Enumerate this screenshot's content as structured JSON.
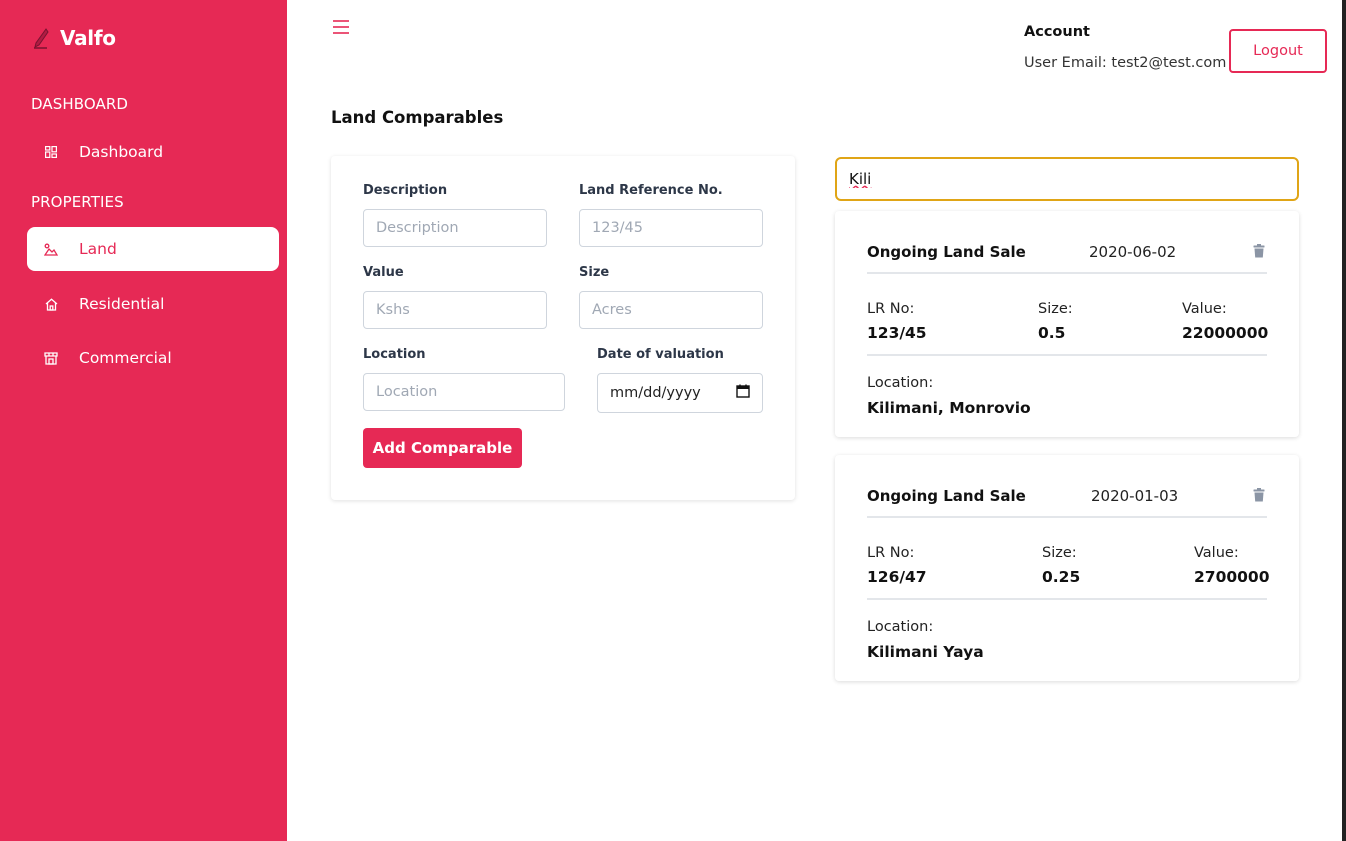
{
  "brand": {
    "name": "Valfo",
    "accent": "#e62955"
  },
  "sidebar": {
    "sections": [
      {
        "label": "DASHBOARD"
      },
      {
        "label": "PROPERTIES"
      }
    ],
    "items": [
      {
        "label": "Dashboard",
        "icon": "grid-icon",
        "active": false
      },
      {
        "label": "Land",
        "icon": "land-icon",
        "active": true
      },
      {
        "label": "Residential",
        "icon": "home-icon",
        "active": false
      },
      {
        "label": "Commercial",
        "icon": "store-icon",
        "active": false
      }
    ]
  },
  "header": {
    "account_title": "Account",
    "account_email": "User Email: test2@test.com",
    "logout_label": "Logout"
  },
  "page": {
    "title": "Land Comparables"
  },
  "form": {
    "description": {
      "label": "Description",
      "placeholder": "Description"
    },
    "reference": {
      "label": "Land Reference No.",
      "placeholder": "123/45"
    },
    "value": {
      "label": "Value",
      "placeholder": "Kshs"
    },
    "size": {
      "label": "Size",
      "placeholder": "Acres"
    },
    "location": {
      "label": "Location",
      "placeholder": "Location"
    },
    "date": {
      "label": "Date of valuation",
      "placeholder": "mm/dd/yyyy"
    },
    "submit_label": "Add Comparable"
  },
  "search": {
    "value": "Kili"
  },
  "results": [
    {
      "title": "Ongoing Land Sale",
      "date": "2020-06-02",
      "lr_label": "LR No:",
      "lr": "123/45",
      "size_label": "Size:",
      "size": "0.5",
      "value_label": "Value:",
      "value": "22000000",
      "location_label": "Location:",
      "location": "Kilimani, Monrovio"
    },
    {
      "title": "Ongoing Land Sale",
      "date": "2020-01-03",
      "lr_label": "LR No:",
      "lr": "126/47",
      "size_label": "Size:",
      "size": "0.25",
      "value_label": "Value:",
      "value": "2700000",
      "location_label": "Location:",
      "location": "Kilimani Yaya"
    }
  ]
}
